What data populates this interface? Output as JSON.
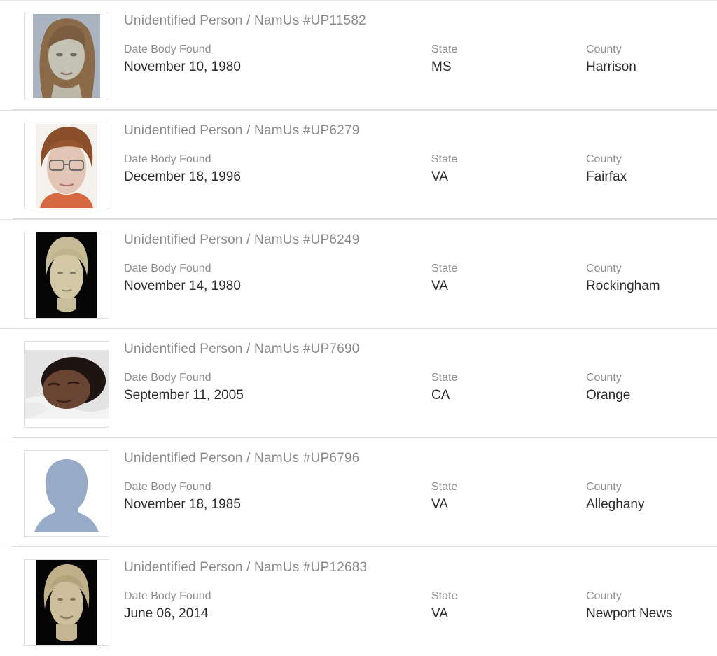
{
  "labels": {
    "date": "Date Body Found",
    "state": "State",
    "county": "County"
  },
  "records": [
    {
      "title": "Unidentified Person / NamUs #UP11582",
      "date": "November 10, 1980",
      "state": "MS",
      "county": "Harrison",
      "photo": "clay-reconstruction-female-long-hair-icon"
    },
    {
      "title": "Unidentified Person / NamUs #UP6279",
      "date": "December 18, 1996",
      "state": "VA",
      "county": "Fairfax",
      "photo": "sketch-woman-glasses-icon"
    },
    {
      "title": "Unidentified Person / NamUs #UP6249",
      "date": "November 14, 1980",
      "state": "VA",
      "county": "Rockingham",
      "photo": "clay-bust-black-background-icon"
    },
    {
      "title": "Unidentified Person / NamUs #UP7690",
      "date": "September 11, 2005",
      "state": "CA",
      "county": "Orange",
      "photo": "postmortem-photo-icon"
    },
    {
      "title": "Unidentified Person / NamUs #UP6796",
      "date": "November 18, 1985",
      "state": "VA",
      "county": "Alleghany",
      "photo": "silhouette-placeholder-icon"
    },
    {
      "title": "Unidentified Person / NamUs #UP12683",
      "date": "June 06, 2014",
      "state": "VA",
      "county": "Newport News",
      "photo": "clay-bust-black-background-icon"
    }
  ],
  "colors": {
    "title": "#8a8a8a",
    "label": "#8e8e8e",
    "value": "#2b2b2b",
    "silhouette": "#97aac8",
    "divider": "#dcdcdc"
  }
}
